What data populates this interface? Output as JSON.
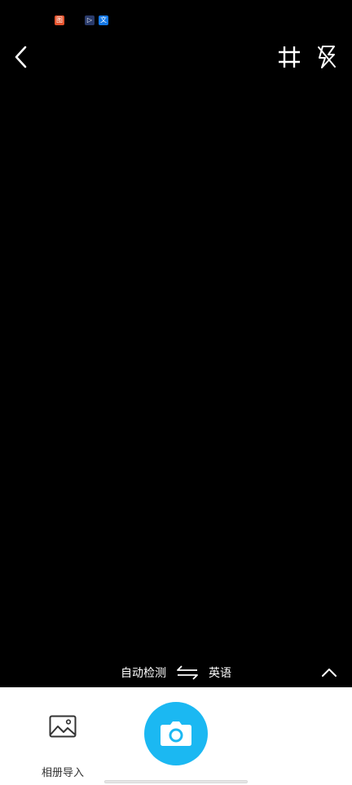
{
  "status_bar": {
    "icons": [
      {
        "name": "app-notification-icon",
        "glyph": "图",
        "color": "#e5532d"
      },
      {
        "name": "video-app-icon",
        "glyph": "▷",
        "color": "#2a3b6b"
      },
      {
        "name": "translate-app-icon",
        "glyph": "文",
        "color": "#1478e6"
      }
    ]
  },
  "topbar": {
    "back_icon": "chevron-left-icon",
    "crop_icon": "crop-icon",
    "flash_icon": "flash-off-icon"
  },
  "language": {
    "source": "自动检测",
    "target": "英语",
    "swap_icon": "swap-arrows-icon",
    "expand_icon": "chevron-up-icon"
  },
  "bottom": {
    "album_label": "相册导入",
    "album_icon": "image-icon",
    "shutter_icon": "camera-icon",
    "accent_color": "#1bb8f2"
  }
}
